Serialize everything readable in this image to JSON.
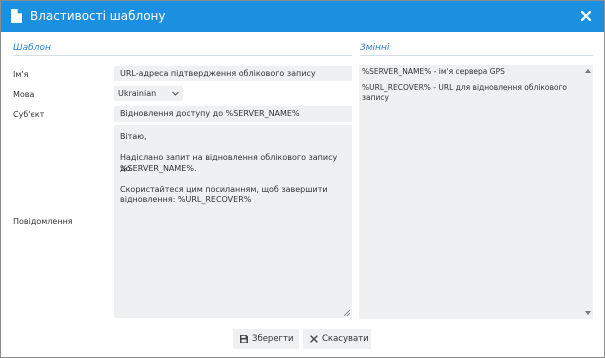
{
  "dialog": {
    "title": "Властивості шаблону",
    "title_icon": "document-icon",
    "close_icon": "close-icon"
  },
  "template_section": {
    "heading": "Шаблон",
    "name_label": "Ім'я",
    "name_value": "URL-адреса підтвердження облікового запису",
    "language_label": "Мова",
    "language_value": "Ukrainian",
    "subject_label": "Суб'єкт",
    "subject_value": "Відновлення доступу до %SERVER_NAME%",
    "message_label": "Повідомлення",
    "message_lines": [
      "Вітаю,",
      "",
      "Надіслано запит на відновлення облікового запису до",
      "%SERVER_NAME%.",
      "",
      "Скористайтеся цим посиланням, щоб завершити",
      "відновлення: %URL_RECOVER%"
    ]
  },
  "variables_section": {
    "heading": "Змінні",
    "items": [
      "%SERVER_NAME% - ім'я сервера GPS",
      "%URL_RECOVER% - URL для відновлення облікового запису"
    ]
  },
  "buttons": {
    "save_label": "Зберегти",
    "save_icon": "floppy-disk-icon",
    "cancel_label": "Скасувати",
    "cancel_icon": "close-icon"
  },
  "colors": {
    "titlebar": "#1b8fe0",
    "section_heading": "#2a82d4",
    "field_background": "#eef0f2"
  }
}
